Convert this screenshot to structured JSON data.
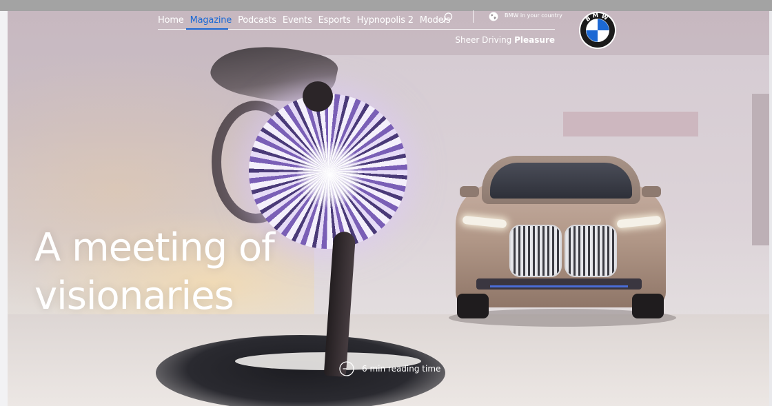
{
  "nav": {
    "items": [
      {
        "label": "Home",
        "active": false
      },
      {
        "label": "Magazine",
        "active": true
      },
      {
        "label": "Podcasts",
        "active": false
      },
      {
        "label": "Events",
        "active": false
      },
      {
        "label": "Esports",
        "active": false
      },
      {
        "label": "Hypnopolis 2",
        "active": false
      },
      {
        "label": "Models",
        "active": false
      }
    ],
    "search_icon": "search-icon",
    "country_label": "BMW in your country",
    "globe_icon": "globe-icon"
  },
  "tagline": {
    "regular": "Sheer Driving ",
    "bold": "Pleasure"
  },
  "logo": {
    "letters": "BMW",
    "colors": {
      "blue": "#1c69d4",
      "white": "#ffffff",
      "ring": "#1b1b1b"
    }
  },
  "hero": {
    "headline_line1": "A meeting of",
    "headline_line2": "visionaries",
    "reading_time": "6 min reading time",
    "reading_icon": "clock-icon"
  },
  "colors": {
    "accent": "#1c69d4",
    "text_on_image": "#ffffff"
  }
}
